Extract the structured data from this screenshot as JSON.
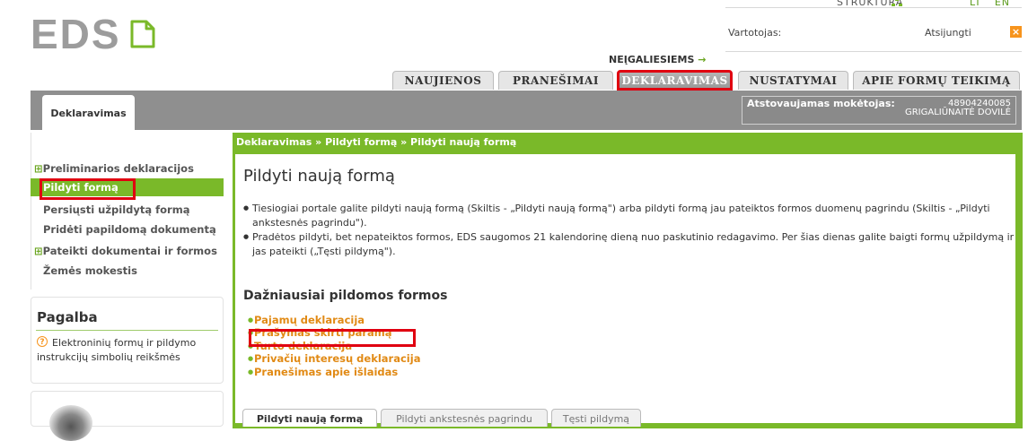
{
  "header": {
    "logo": "EDS",
    "struktura": "STRUKTŪRA",
    "lang_lt": "LT",
    "lang_en": "EN",
    "vartotojas_label": "Vartotojas:",
    "atsijungti": "Atsijungti",
    "neigaliesiems": "NEĮGALIESIEMS",
    "neig_arrow": "→"
  },
  "tabs": [
    {
      "label": "NAUJIENOS"
    },
    {
      "label": "PRANEŠIMAI"
    },
    {
      "label": "DEKLARAVIMAS"
    },
    {
      "label": "NUSTATYMAI"
    },
    {
      "label": "APIE FORMŲ TEIKIMĄ"
    }
  ],
  "subnav": {
    "active_tab": "Deklaravimas",
    "atstov_label": "Atstovaujamas mokėtojas:",
    "atstov_number": "48904240085",
    "atstov_name": "GRIGALIŪNAITĖ DOVILĖ"
  },
  "sidebar": {
    "items": [
      {
        "label": "Preliminarios deklaracijos",
        "expand": "⊞"
      },
      {
        "label": "Pildyti formą"
      },
      {
        "label": "Persiųsti užpildytą formą"
      },
      {
        "label": "Pridėti papildomą dokumentą"
      },
      {
        "label": "Pateikti dokumentai ir formos",
        "expand": "⊞"
      },
      {
        "label": "Žemės mokestis"
      }
    ],
    "pagalba_title": "Pagalba",
    "pagalba_link": "Elektroninių formų ir pildymo instrukcijų simbolių reikšmės"
  },
  "main": {
    "breadcrumb": "Deklaravimas » Pildyti formą » Pildyti naują formą",
    "title": "Pildyti naują formą",
    "bullets": [
      "Tiesiogiai portale galite pildyti naują formą (Skiltis - „Pildyti naują formą\") arba pildyti formą jau pateiktos formos duomenų pagrindu (Skiltis - „Pildyti ankstesnės pagrindu\").",
      "Pradėtos pildyti, bet nepateiktos formos, EDS saugomos 21 kalendorinę dieną nuo paskutinio redagavimo. Per šias dienas galite baigti formų užpildymą ir jas pateikti („Tęsti pildymą\")."
    ],
    "frequent_title": "Dažniausiai pildomos formos",
    "frequent_forms": [
      "Pajamų deklaracija",
      "Prašymas skirti paramą",
      "Turto deklaracija",
      "Privačių interesų deklaracija",
      "Pranešimas apie išlaidas"
    ],
    "bottom_tabs": [
      "Pildyti naują formą",
      "Pildyti ankstesnės pagrindu",
      "Tęsti pildymą"
    ]
  },
  "colors": {
    "green": "#7ab929",
    "orange": "#e18a15",
    "highlight_red": "#e00010",
    "gray_band": "#8f8f8f"
  }
}
